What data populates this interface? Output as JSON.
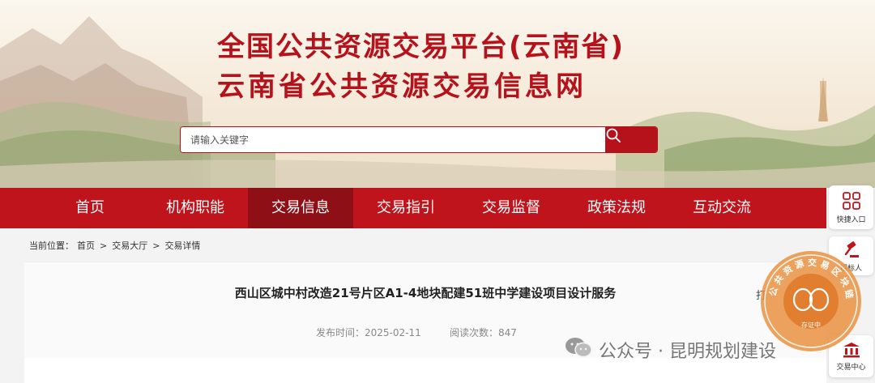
{
  "header": {
    "title_line1": "全国公共资源交易平台(云南省)",
    "title_line2": "云南省公共资源交易信息网"
  },
  "search": {
    "placeholder": "请输入关键字",
    "button_icon": "search-icon"
  },
  "nav": {
    "items": [
      {
        "label": "首页"
      },
      {
        "label": "机构职能"
      },
      {
        "label": "交易信息"
      },
      {
        "label": "交易指引"
      },
      {
        "label": "交易监督"
      },
      {
        "label": "政策法规"
      },
      {
        "label": "互动交流"
      }
    ],
    "active_index": 2
  },
  "breadcrumb": {
    "prefix": "当前位置：",
    "items": [
      "首页",
      "交易大厅",
      "交易详情"
    ],
    "separator": ">"
  },
  "article": {
    "title": "西山区城中村改造21号片区A1-4地块配建51班中学建设项目设计服务",
    "publish_label": "发布时间：",
    "publish_date": "2025-02-11",
    "views_label": "阅读次数：",
    "views": "847",
    "print_label": "打"
  },
  "sidebar": {
    "quick_entry": "快捷入口",
    "bidder": "招标人",
    "trading_center": "交易中心"
  },
  "watermark": {
    "text": "公众号 · 昆明规划建设"
  },
  "seal": {
    "ring_text": "公共资源交易区块链",
    "center_text": "存证中"
  },
  "colors": {
    "brand_red": "#c0141d",
    "active_nav": "#8e0f16",
    "seal_orange": "#e07a2a"
  }
}
